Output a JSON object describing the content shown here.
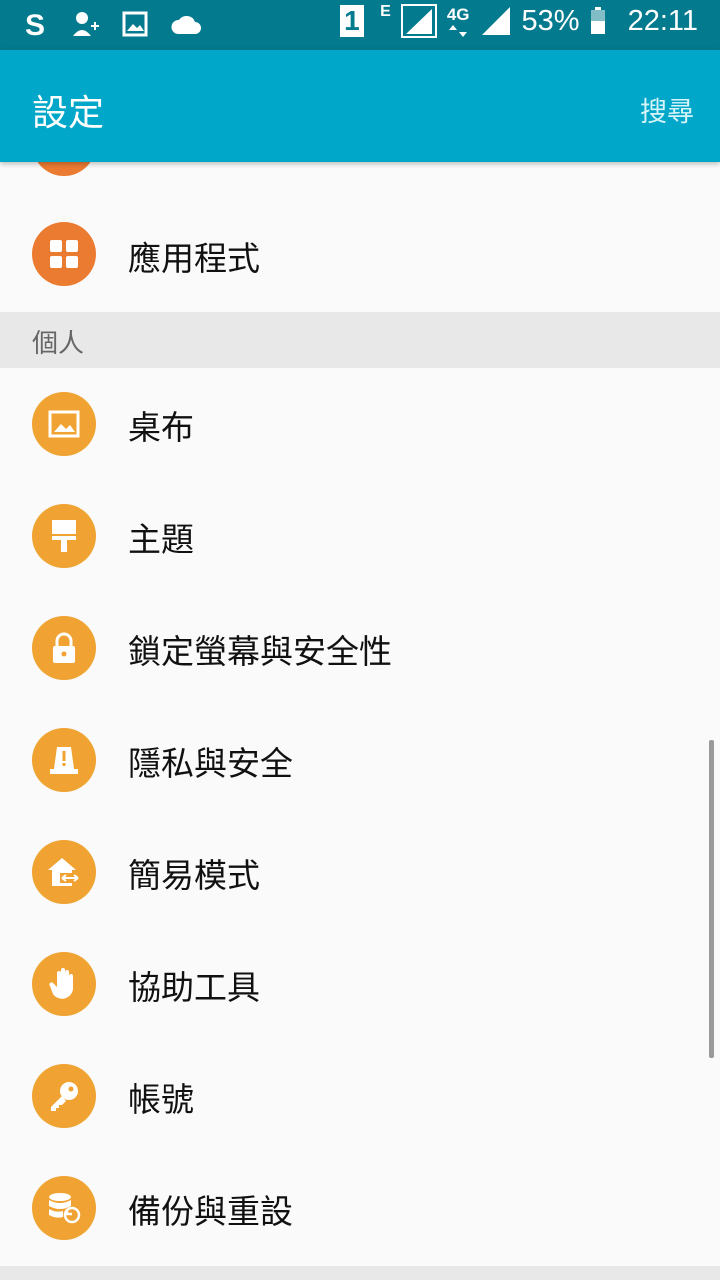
{
  "status": {
    "battery": "53%",
    "time": "22:11",
    "network": "4G",
    "edge": "E",
    "sim": "1"
  },
  "appbar": {
    "title": "設定",
    "search": "搜尋"
  },
  "list": {
    "apps_label": "應用程式",
    "section_personal": "個人",
    "items": [
      {
        "label": "桌布",
        "icon": "wallpaper-icon"
      },
      {
        "label": "主題",
        "icon": "theme-brush-icon"
      },
      {
        "label": "鎖定螢幕與安全性",
        "icon": "lock-icon"
      },
      {
        "label": "隱私與安全",
        "icon": "privacy-alert-icon"
      },
      {
        "label": "簡易模式",
        "icon": "easy-mode-home-icon"
      },
      {
        "label": "協助工具",
        "icon": "hand-icon"
      },
      {
        "label": "帳號",
        "icon": "key-icon"
      },
      {
        "label": "備份與重設",
        "icon": "backup-reset-icon"
      }
    ]
  },
  "colors": {
    "appbar": "#00a7c8",
    "statusbar": "#037a8d",
    "icon_orange": "#f0a232",
    "icon_apps": "#ec7b32"
  }
}
